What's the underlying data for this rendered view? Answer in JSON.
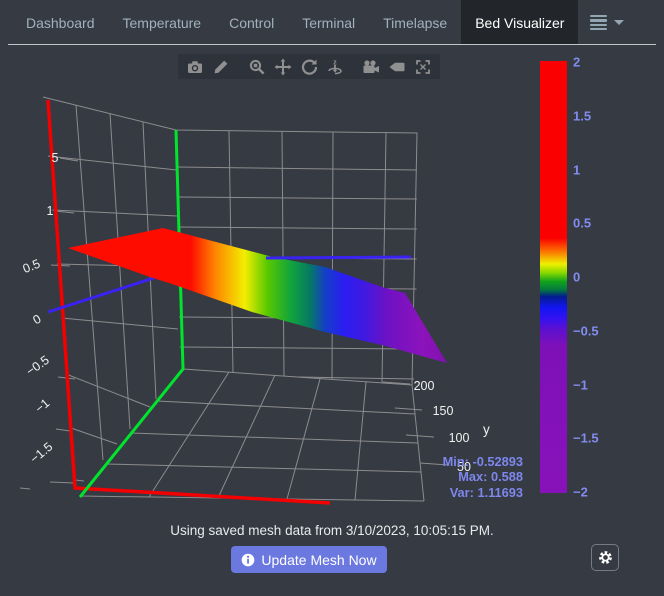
{
  "navbar": {
    "tabs": [
      {
        "label": "Dashboard",
        "active": false
      },
      {
        "label": "Temperature",
        "active": false
      },
      {
        "label": "Control",
        "active": false
      },
      {
        "label": "Terminal",
        "active": false
      },
      {
        "label": "Timelapse",
        "active": false
      },
      {
        "label": "Bed Visualizer",
        "active": true
      }
    ],
    "menu_icon": "hamburger-icon",
    "menu_caret_icon": "caret-down-icon"
  },
  "plot": {
    "modebar_buttons": [
      "camera-icon",
      "pencil-icon",
      "zoom-3d-icon",
      "pan-3d-icon",
      "orbit-rotation-icon",
      "turntable-rotation-icon",
      "reset-camera-icon",
      "reset-camera-last-save-icon",
      "hover-closest-icon"
    ],
    "z_ticks": [
      "5",
      "1",
      "0.5",
      "0",
      "−0.5",
      "−1",
      "−1.5"
    ],
    "y_axis": {
      "title": "y",
      "ticks": [
        "200",
        "150",
        "100",
        "50"
      ]
    },
    "stats": {
      "min_label": "Min: -0.52893",
      "max_label": "Max: 0.588",
      "var_label": "Var: 1.11693"
    },
    "colorbar_ticks": [
      "2",
      "1.5",
      "1",
      "0.5",
      "0",
      "−0.5",
      "−1",
      "−1.5",
      "−2"
    ]
  },
  "chart_data": {
    "type": "heatmap",
    "subtype": "3d-surface-bed-mesh",
    "title": "",
    "xlabel": "",
    "ylabel": "y",
    "y_tick_values": [
      50,
      100,
      150,
      200
    ],
    "z_tick_labels_visible": [
      "5",
      "1",
      "0.5",
      "0",
      "-0.5",
      "-1",
      "-1.5"
    ],
    "colorbar": {
      "range": [
        -2,
        2
      ],
      "ticks": [
        2,
        1.5,
        1,
        0.5,
        0,
        -0.5,
        -1,
        -1.5,
        -2
      ],
      "color_stops_top_to_bottom": [
        {
          "value": 2.0,
          "color": "#fb0000"
        },
        {
          "value": 0.45,
          "color": "#fb0000"
        },
        {
          "value": 0.25,
          "color": "#fc7000"
        },
        {
          "value": 0.12,
          "color": "#eef000"
        },
        {
          "value": 0.0,
          "color": "#12a41c"
        },
        {
          "value": -0.08,
          "color": "#041c8c"
        },
        {
          "value": -0.15,
          "color": "#1216f0"
        },
        {
          "value": -0.3,
          "color": "#7e10b8"
        },
        {
          "value": -2.0,
          "color": "#8812ba"
        }
      ]
    },
    "stats": {
      "min": -0.52893,
      "max": 0.588,
      "var": 1.11693
    },
    "surface_profile_estimate_left_to_right": [
      0.59,
      0.5,
      0.3,
      0.1,
      -0.05,
      -0.2,
      -0.35,
      -0.5,
      -0.53
    ],
    "grid": true,
    "legend": "none"
  },
  "footer": {
    "status_text": "Using saved mesh data from 3/10/2023, 10:05:15 PM.",
    "update_button_label": "Update Mesh Now",
    "update_button_icon": "info-circle-icon",
    "settings_icon": "gear-icon"
  },
  "colors": {
    "page_background": "#363a43",
    "active_tab_background": "#22262b",
    "nav_text": "#9fb2bd",
    "accent_button": "#6b78df",
    "annotation_text": "#828cee",
    "axis_x_line": "#ff0000",
    "axis_y_line": "#00e52c",
    "axis_z_line": "#3a22f2",
    "grid_line": "#9b9b9b"
  }
}
